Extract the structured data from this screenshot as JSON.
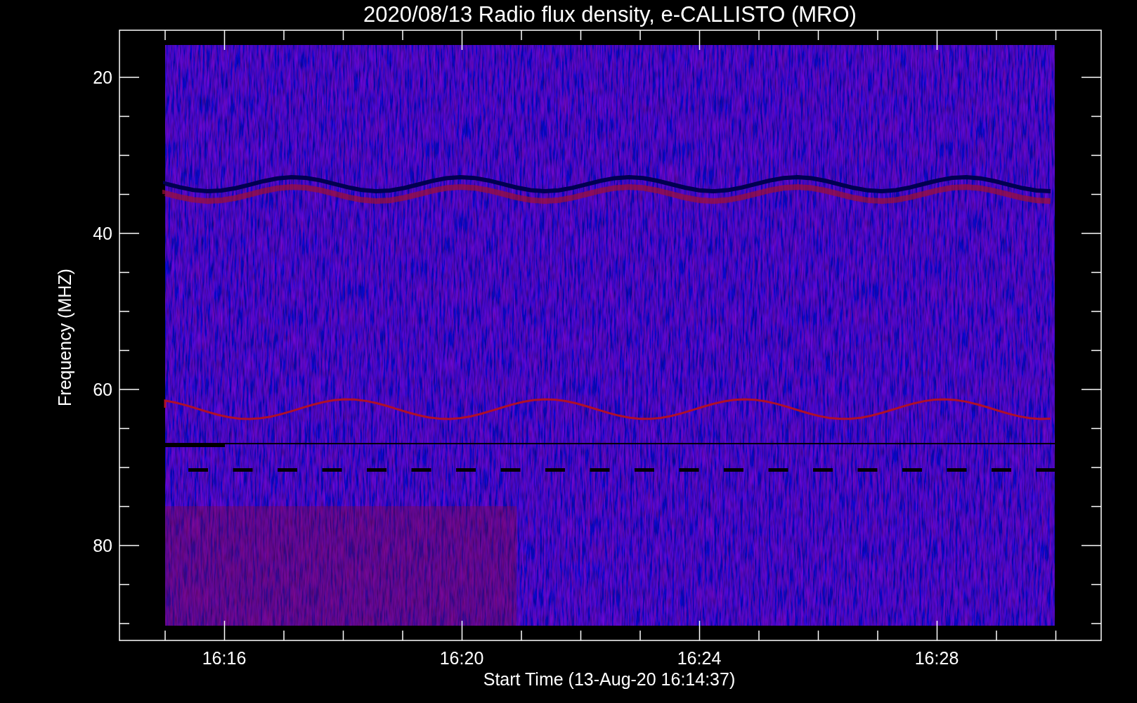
{
  "title": "2020/08/13  Radio flux density, e-CALLISTO (MRO)",
  "y_axis": {
    "label": "Frequency (MHZ)",
    "ticks": [
      "20",
      "40",
      "60",
      "80"
    ]
  },
  "x_axis": {
    "label": "Start Time (13-Aug-20 16:14:37)",
    "ticks": [
      "16:16",
      "16:20",
      "16:24",
      "16:28"
    ]
  }
}
